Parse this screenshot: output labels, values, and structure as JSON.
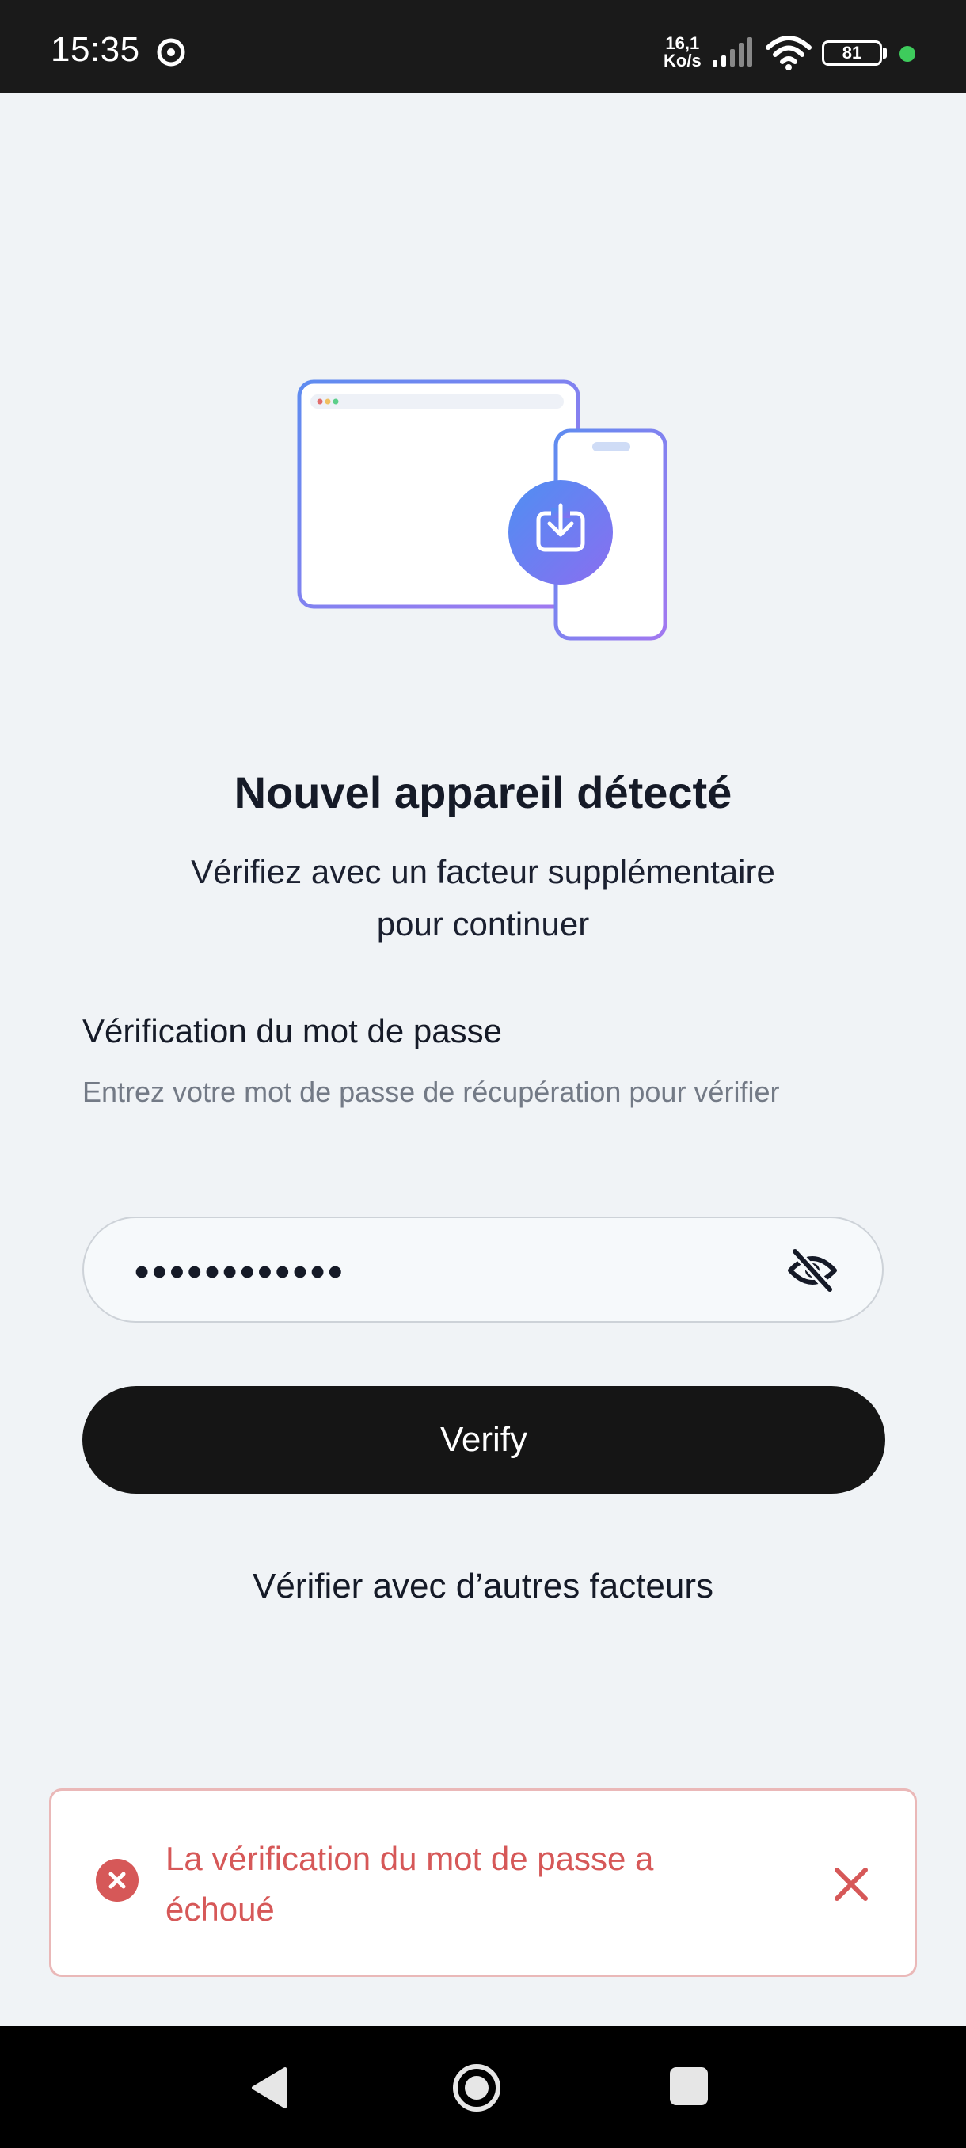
{
  "status_bar": {
    "time": "15:35",
    "net_speed_value": "16,1",
    "net_speed_unit": "Ko/s",
    "battery_level": "81",
    "icons": [
      "chrome-icon",
      "signal-icon",
      "wifi-icon",
      "battery-icon"
    ]
  },
  "screen": {
    "title": "Nouvel appareil détecté",
    "subtitle": "Vérifiez avec un facteur supplémentaire pour continuer"
  },
  "password_section": {
    "label": "Vérification du mot de passe",
    "help": "Entrez votre mot de passe de récupération pour vérifier",
    "field_value": "••••••••••••",
    "toggle_icon": "eye-off-icon"
  },
  "actions": {
    "verify_label": "Verify",
    "other_factors_label": "Vérifier avec d’autres facteurs"
  },
  "error_toast": {
    "message": "La vérification du mot de passe a échoué",
    "icon": "error-icon",
    "close_icon": "close-icon"
  },
  "colors": {
    "background": "#f0f3f6",
    "primary_button": "#151515",
    "error": "#d65858",
    "illustration_blue": "#5f8cf0",
    "illustration_purple": "#a278f0"
  }
}
